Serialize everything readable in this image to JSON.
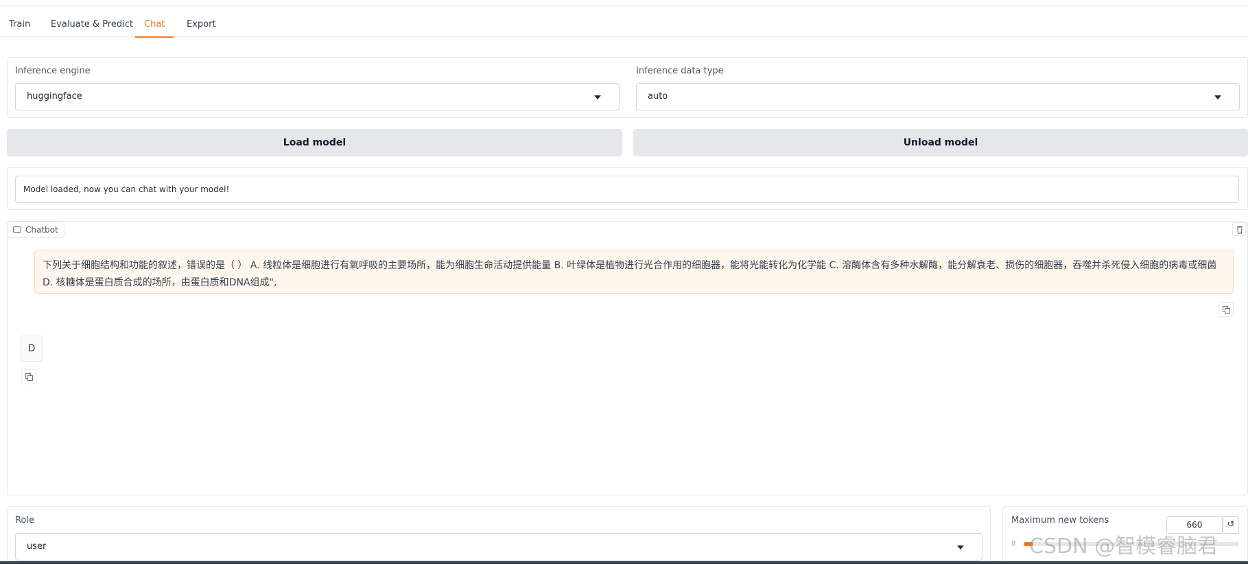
{
  "tabs": [
    {
      "label": "Train"
    },
    {
      "label": "Evaluate & Predict"
    },
    {
      "label": "Chat"
    },
    {
      "label": "Export"
    }
  ],
  "active_tab": "Chat",
  "engine": {
    "label": "Inference engine",
    "value": "huggingface"
  },
  "dtype": {
    "label": "Inference data type",
    "value": "auto"
  },
  "buttons": {
    "load": "Load model",
    "unload": "Unload model"
  },
  "status_text": "Model loaded, now you can chat with your model!",
  "chatbot": {
    "label": "Chatbot",
    "user_message": "下列关于细胞结构和功能的叙述，错误的是（ ） A. 线粒体是细胞进行有氧呼吸的主要场所，能为细胞生命活动提供能量 B. 叶绿体是植物进行光合作用的细胞器，能将光能转化为化学能 C. 溶酶体含有多种水解酶，能分解衰老、损伤的细胞器，吞噬并杀死侵入细胞的病毒或细菌 D. 核糖体是蛋白质合成的场所，由蛋白质和DNA组成\",",
    "bot_message": "D"
  },
  "role": {
    "label": "Role",
    "value": "user"
  },
  "max_tokens": {
    "label": "Maximum new tokens",
    "value": "660",
    "min": "8",
    "fraction": 0.03
  },
  "watermark": "CSDN @智模睿脑君",
  "colors": {
    "accent": "#f97316",
    "user_bubble": "#fff7ed",
    "button": "#e5e7eb"
  }
}
